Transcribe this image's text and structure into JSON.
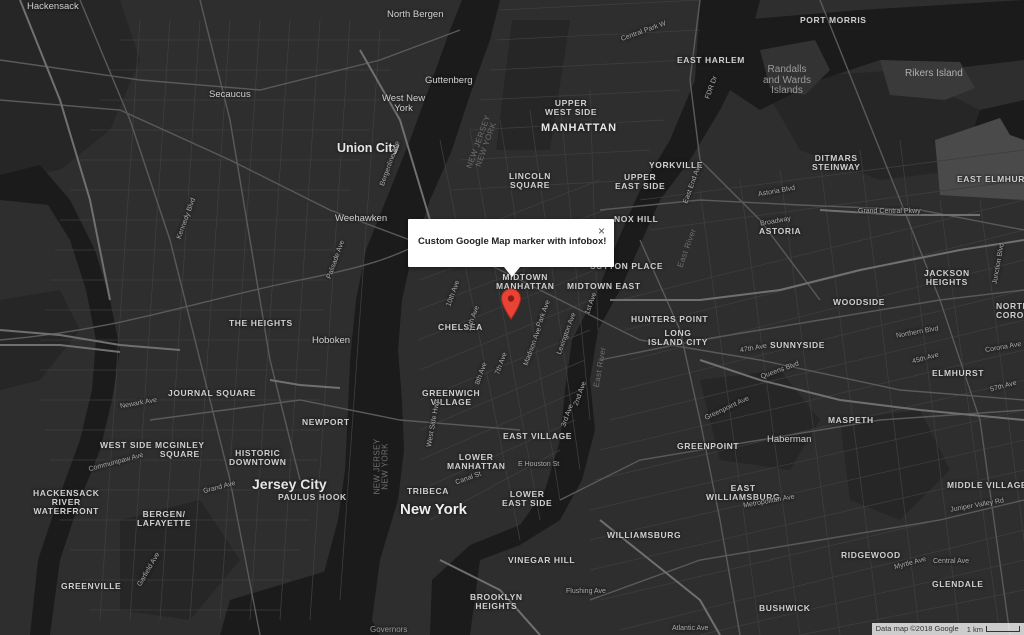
{
  "map": {
    "theme": "dark",
    "colors": {
      "land": "#2e2e2e",
      "land_dark": "#232323",
      "water": "#191919",
      "road": "#4e4e4e",
      "highway": "#6a6a6a",
      "label": "#d8d8d8",
      "marker": "#e84335"
    },
    "labels": {
      "hackensack": "Hackensack",
      "north_bergen": "North Bergen",
      "secaucus": "Secaucus",
      "guttenberg": "Guttenberg",
      "west_new_york": "West New\nYork",
      "union_city": "Union City",
      "weehawken": "Weehawken",
      "the_heights": "THE HEIGHTS",
      "hoboken": "Hoboken",
      "journal_square": "JOURNAL SQUARE",
      "west_side": "WEST SIDE",
      "mcginley_square": "MCGINLEY\nSQUARE",
      "historic_downtown": "HISTORIC\nDOWNTOWN",
      "newport": "NEWPORT",
      "jersey_city": "Jersey City",
      "paulus_hook": "PAULUS HOOK",
      "hackensack_river_waterfront": "HACKENSACK\nRIVER\nWATERFRONT",
      "bergen_lafayette": "BERGEN/\nLAFAYETTE",
      "greenville": "GREENVILLE",
      "upper_west_side": "UPPER\nWEST SIDE",
      "manhattan": "MANHATTAN",
      "lincoln_square": "LINCOLN\nSQUARE",
      "yorkville": "YORKVILLE",
      "upper_east_side": "UPPER\nEAST SIDE",
      "east_harlem": "EAST HARLEM",
      "lenox_hill": "NOX HILL",
      "sutton_place": "SUTTON PLACE",
      "midtown_manhattan": "MIDTOWN\nMANHATTAN",
      "midtown_east": "MIDTOWN EAST",
      "chelsea": "CHELSEA",
      "greenwich_village": "GREENWICH\nVILLAGE",
      "east_village": "EAST VILLAGE",
      "lower_manhattan": "LOWER\nMANHATTAN",
      "lower_east_side": "LOWER\nEAST SIDE",
      "tribeca": "TRIBECA",
      "new_york": "New York",
      "vinegar_hill": "VINEGAR HILL",
      "brooklyn_heights": "BROOKLYN\nHEIGHTS",
      "port_morris": "PORT MORRIS",
      "randalls_wards": "Randalls\nand Wards\nIslands",
      "rikers_island": "Rikers Island",
      "ditmars_steinway": "DITMARS\nSTEINWAY",
      "astoria": "ASTORIA",
      "east_elmhurst": "EAST ELMHURST",
      "jackson_heights": "JACKSON\nHEIGHTS",
      "woodside": "WOODSIDE",
      "hunters_point": "HUNTERS POINT",
      "long_island_city": "LONG\nISLAND CITY",
      "sunnyside": "SUNNYSIDE",
      "elmhurst": "ELMHURST",
      "maspeth": "MASPETH",
      "greenpoint": "GREENPOINT",
      "haberman": "Haberman",
      "east_williamsburg": "EAST\nWILLIAMSBURG",
      "williamsburg": "WILLIAMSBURG",
      "ridgewood": "RIDGEWOOD",
      "middle_village": "MIDDLE VILLAGE",
      "glendale": "GLENDALE",
      "bushwick": "BUSHWICK",
      "north_corona": "NORTH\nCORO",
      "governors": "Governors",
      "river_new_jersey_1": "NEW JERSEY\nNEW YORK",
      "river_new_jersey_2": "NEW JERSEY\nNEW YORK",
      "east_river": "East River",
      "east_river_2": "East River"
    },
    "streets": {
      "astoria_blvd": "Astoria Blvd",
      "queens_blvd": "Queens Blvd",
      "grand_central_pkwy": "Grand Central Pkwy",
      "northern_blvd": "Northern Blvd",
      "broadway_q": "Broadway",
      "greenpoint_ave": "Greenpoint Ave",
      "metropolitan_ave": "Metropolitan Ave",
      "flushing_ave": "Flushing Ave",
      "myrtle_ave": "Myrtle Ave",
      "grand_ave": "Grand Ave",
      "houston_st": "E Houston St",
      "canal_st": "Canal St",
      "lexington_ave": "Lexington Ave",
      "madison_ave": "Madison Ave",
      "park_ave": "Park Ave",
      "west_side_hwy": "West Side Hwy",
      "kennedy_blvd": "Kennedy Blvd",
      "palisade_ave": "Palisade Ave",
      "bergenline_ave": "Bergenline Ave",
      "central_park_w": "Central Park W",
      "east_end_ave": "East End Ave",
      "fdr_dr": "FDR Dr",
      "newark_ave": "Newark Ave",
      "communipaw_ave": "Communipaw Ave",
      "garfield_ave": "Garfield Ave",
      "atlantic_ave": "Atlantic Ave",
      "central_ave": "Central Ave",
      "junction_blvd": "Junction Blvd",
      "corona_ave": "Corona Ave",
      "jkw_blvd": "Juniper Valley Rd",
      "third_ave": "3rd Ave",
      "second_ave": "2nd Ave",
      "seventh_ave": "7th Ave",
      "eighth_ave": "8th Ave",
      "tenth_ave": "10th Ave",
      "eleventh_ave": "11th Ave",
      "first_ave": "1st Ave",
      "fortyseventh_ave": "47th Ave",
      "fortyfifth_ave": "45th Ave",
      "fiftyseventh_ave": "57th Ave"
    },
    "infobox": {
      "text": "Custom Google Map marker with infobox!",
      "close": "×"
    },
    "marker_icon": "map-pin-icon",
    "footer": {
      "data": "Data map ©2018 Google",
      "scale": "1 km"
    }
  }
}
